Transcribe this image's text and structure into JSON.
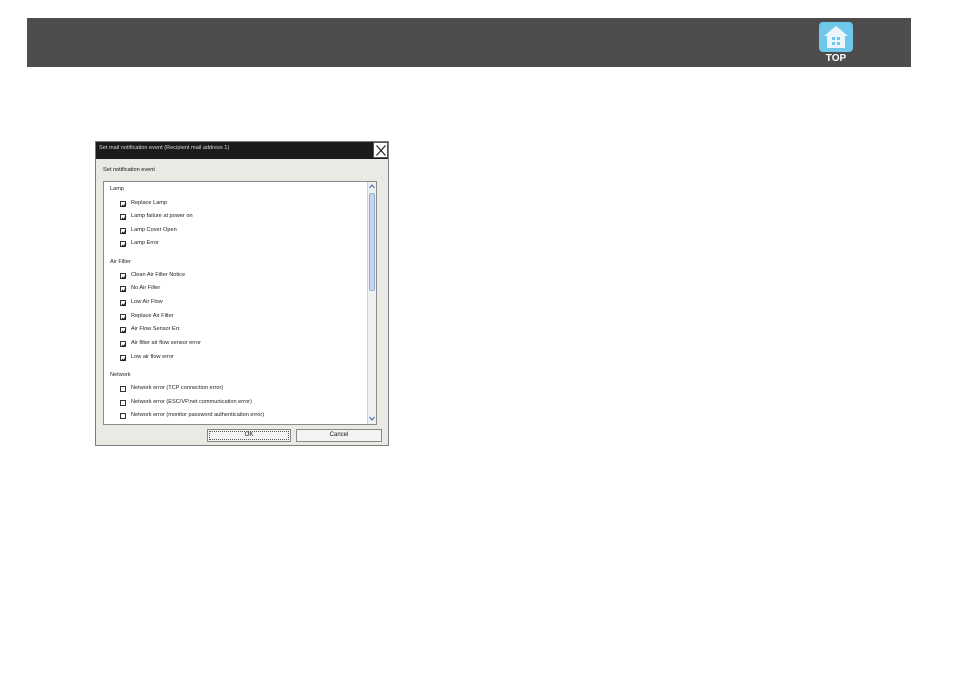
{
  "header": {
    "top_label": "TOP"
  },
  "dialog": {
    "title": "Set mail notification event (Recipient mail address 1)",
    "group_caption": "Set notification event",
    "categories": {
      "lamp": "Lamp",
      "air_filter": "Air Filter",
      "network": "Network"
    },
    "lamp_items": [
      {
        "label": "Replace Lamp",
        "checked": true
      },
      {
        "label": "Lamp failure at power on",
        "checked": true
      },
      {
        "label": "Lamp Cover Open",
        "checked": true
      },
      {
        "label": "Lamp Error",
        "checked": true
      }
    ],
    "air_filter_items": [
      {
        "label": "Clean Air Filter Notice",
        "checked": true
      },
      {
        "label": "No Air Filter",
        "checked": true
      },
      {
        "label": "Low Air Flow",
        "checked": true
      },
      {
        "label": "Replace Air Filter",
        "checked": true
      },
      {
        "label": "Air Flow Sensor Err.",
        "checked": true
      },
      {
        "label": "Air filter air flow sensor error",
        "checked": true
      },
      {
        "label": "Low air flow error",
        "checked": true
      }
    ],
    "network_items": [
      {
        "label": "Network error (TCP connection error)",
        "checked": false
      },
      {
        "label": "Network error (ESC/VP.net communication error)",
        "checked": false
      },
      {
        "label": "Network error (monitor password authentication error)",
        "checked": false
      }
    ],
    "ok_label": "OK",
    "cancel_label": "Cancel"
  }
}
